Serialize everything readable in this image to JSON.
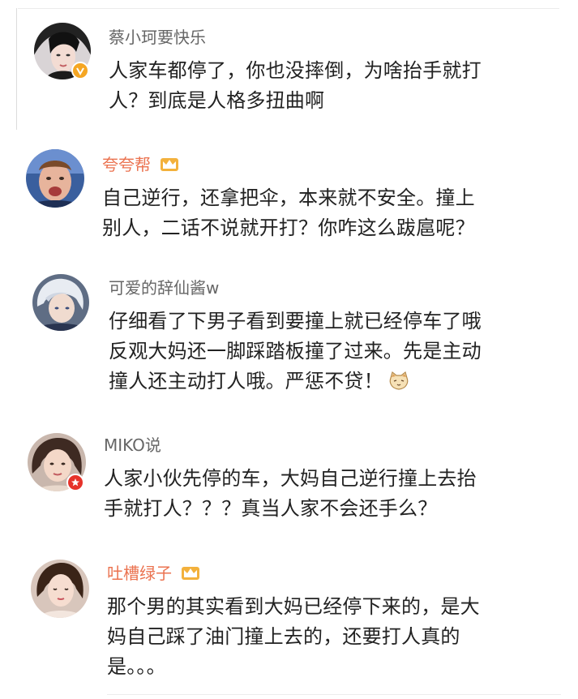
{
  "comments": [
    {
      "username": "蔡小珂要快乐",
      "lines": [
        "人家车都停了，你也没摔倒，为啥抬手就打",
        "人？到底是人格多扭曲啊"
      ],
      "verified_badge": "vip-v-icon",
      "name_color": "#666666"
    },
    {
      "username": "夸夸帮",
      "lines": [
        "自己逆行，还拿把伞，本来就不安全。撞上",
        "别人，二话不说就开打？你咋这么跋扈呢？"
      ],
      "name_badge": "crown-icon",
      "name_color": "#eb7350"
    },
    {
      "username": "可爱的辞仙酱w",
      "lines": [
        "仔细看了下男子看到要撞上就已经停车了哦",
        "反观大妈还一脚踩踏板撞了过来。先是主动",
        "撞人还主动打人哦。严惩不贷！"
      ],
      "inline_emoji": "cat-emoji-icon",
      "name_color": "#666666"
    },
    {
      "username": "MIKO说",
      "lines": [
        "人家小伙先停的车，大妈自己逆行撞上去抬",
        "手就打人？？？真当人家不会还手么？"
      ],
      "verified_badge": "red-v-icon",
      "name_color": "#666666"
    },
    {
      "username": "吐槽绿子",
      "lines": [
        "那个男的其实看到大妈已经停下来的，是大",
        "妈自己踩了油门撞上去的，还要打人真的",
        "是。。。"
      ],
      "name_badge": "crown-icon",
      "name_color": "#eb7350"
    }
  ]
}
